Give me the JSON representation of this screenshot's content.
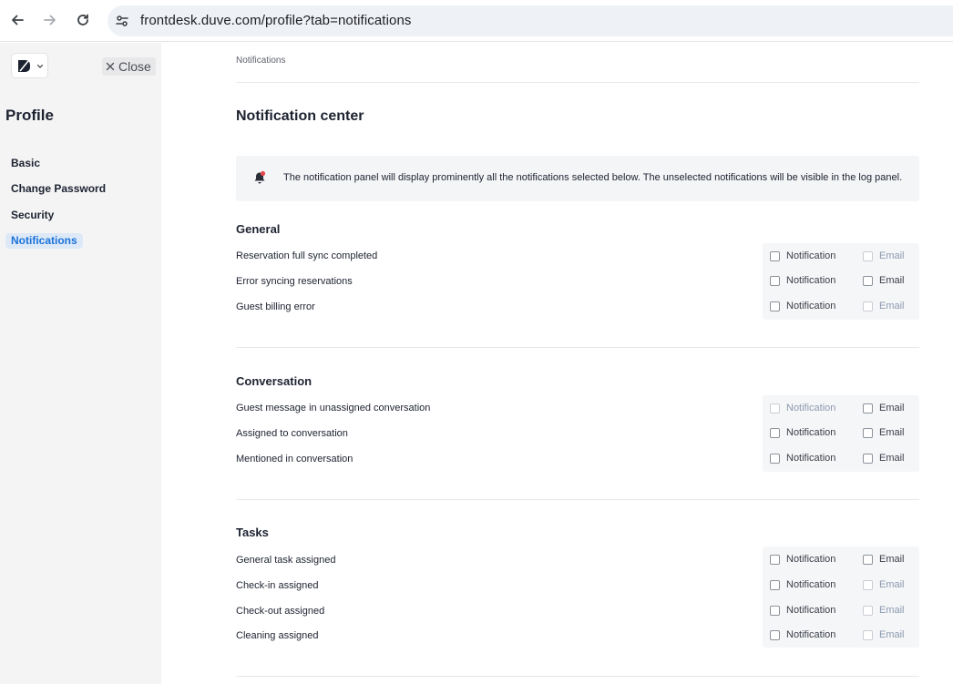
{
  "browser": {
    "url": "frontdesk.duve.com/profile?tab=notifications"
  },
  "sidebar": {
    "close_label": "Close",
    "title": "Profile",
    "items": [
      {
        "label": "Basic",
        "active": false
      },
      {
        "label": "Change Password",
        "active": false
      },
      {
        "label": "Security",
        "active": false
      },
      {
        "label": "Notifications",
        "active": true
      }
    ]
  },
  "main": {
    "breadcrumb": "Notifications",
    "title": "Notification center",
    "info": "The notification panel will display prominently all the notifications selected below. The unselected notifications will be visible in the log panel.",
    "option_labels": {
      "notification": "Notification",
      "email": "Email"
    },
    "sections": [
      {
        "title": "General",
        "rows": [
          {
            "label": "Reservation full sync completed",
            "notification_enabled": true,
            "email_enabled": false
          },
          {
            "label": "Error syncing reservations",
            "notification_enabled": true,
            "email_enabled": true
          },
          {
            "label": "Guest billing error",
            "notification_enabled": true,
            "email_enabled": false
          }
        ]
      },
      {
        "title": "Conversation",
        "rows": [
          {
            "label": "Guest message in unassigned conversation",
            "notification_enabled": false,
            "email_enabled": true
          },
          {
            "label": "Assigned to conversation",
            "notification_enabled": true,
            "email_enabled": true
          },
          {
            "label": "Mentioned in conversation",
            "notification_enabled": true,
            "email_enabled": true
          }
        ]
      },
      {
        "title": "Tasks",
        "rows": [
          {
            "label": "General task assigned",
            "notification_enabled": true,
            "email_enabled": true
          },
          {
            "label": "Check-in assigned",
            "notification_enabled": true,
            "email_enabled": false
          },
          {
            "label": "Check-out assigned",
            "notification_enabled": true,
            "email_enabled": false
          },
          {
            "label": "Cleaning assigned",
            "notification_enabled": true,
            "email_enabled": false
          }
        ]
      }
    ]
  },
  "colors": {
    "accent": "#1a73d9",
    "sidebar_bg": "#f4f4f5",
    "active_item_bg": "#dde9f7",
    "disabled_text": "#8b9aae"
  }
}
